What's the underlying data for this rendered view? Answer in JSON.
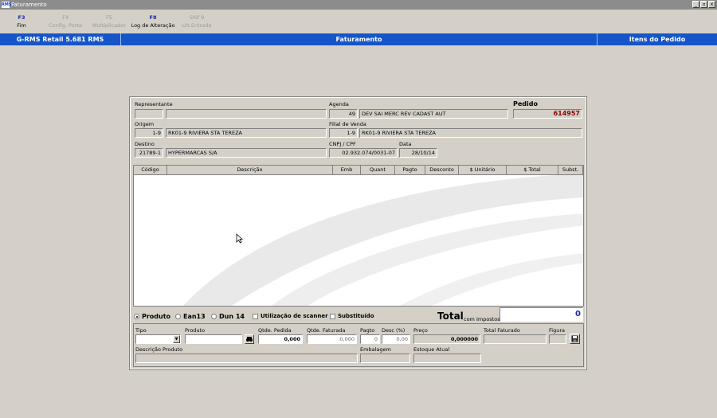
{
  "window": {
    "title": "Faturamento",
    "icon_text": "RMS",
    "btn_min": "_",
    "btn_max": "▫",
    "btn_close": "x"
  },
  "toolbar": [
    {
      "key": "F3",
      "label": "Fim",
      "enabled": true
    },
    {
      "key": "F4",
      "label": "Config. Porta",
      "enabled": false
    },
    {
      "key": "F5",
      "label": "Multiplicador",
      "enabled": false
    },
    {
      "key": "F8",
      "label": "Log de Alteração",
      "enabled": true
    },
    {
      "key": "Shif 9",
      "label": "Ult.Entrada",
      "enabled": false
    }
  ],
  "bluebar": {
    "app": "G-RMS Retail 5.681 RMS",
    "center": "Faturamento",
    "right": "Itens do Pedido"
  },
  "header": {
    "representante_label": "Representante",
    "representante_code": "",
    "representante_name": "",
    "agenda_label": "Agenda",
    "agenda_code": "49",
    "agenda_desc": "DEV SAI MERC REV CADAST AUT",
    "pedido_label": "Pedido",
    "pedido_value": "614957",
    "origem_label": "Origem",
    "origem_code": "1-9",
    "origem_name": "RK01-9 RIVIERA STA TEREZA",
    "filial_label": "Filial de Venda",
    "filial_code": "1-9",
    "filial_name": "RK01-9 RIVIERA STA TEREZA",
    "destino_label": "Destino",
    "destino_code": "21789-1",
    "destino_name": "HYPERMARCAS S/A",
    "cnpj_label": "CNPJ / CPF",
    "cnpj_value": "02.932.074/0031-07",
    "data_label": "Data",
    "data_value": "28/10/14"
  },
  "grid": {
    "columns": [
      "Código",
      "Descrição",
      "Emb",
      "Quant",
      "Pagto",
      "Desconto",
      "$ Unitário",
      "$ Total",
      "Subst."
    ],
    "rows": []
  },
  "options": {
    "produto": "Produto",
    "ean13": "Ean13",
    "dun14": "Dun 14",
    "scanner": "Utilização de scanner",
    "substituido": "Substituído",
    "selected": "produto",
    "total_label": "Total",
    "total_sub": "com Impostos",
    "total_value": "0"
  },
  "entry": {
    "tipo_label": "Tipo",
    "produto_label": "Produto",
    "qtde_pedida_label": "Qtde. Pedida",
    "qtde_pedida": "0,000",
    "qtde_faturada_label": "Qtde. Faturada",
    "qtde_faturada": "0,000",
    "pagto_label": "Pagto",
    "pagto": "0",
    "desc_label": "Desc (%)",
    "desc": "0,00",
    "preco_label": "Preço",
    "preco": "0,000000",
    "total_faturado_label": "Total Faturado",
    "figura_label": "Figura",
    "descricao_label": "Descrição Produto",
    "embalagem_label": "Embalagem",
    "estoque_label": "Estoque Atual"
  }
}
